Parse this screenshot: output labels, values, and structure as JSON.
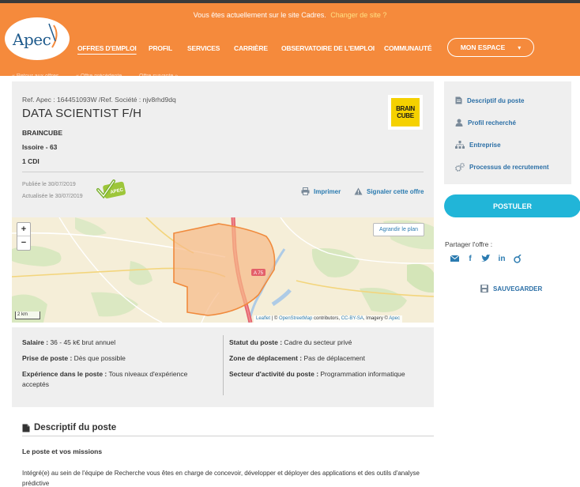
{
  "header": {
    "notice": "Vous êtes actuellement sur le site Cadres.",
    "notice_link": "Changer de site ?",
    "logo_text": "Apec",
    "nav": [
      "OFFRES D'EMPLOI",
      "PROFIL",
      "SERVICES",
      "CARRIÈRE",
      "OBSERVATOIRE DE L'EMPLOI",
      "COMMUNAUTÉ"
    ],
    "mon_espace": "MON ESPACE",
    "crumbs": [
      "« Retour aux offres",
      "« Offre précédente",
      "Offre suivante »"
    ]
  },
  "job": {
    "ref": "Ref. Apec : 164451093W /Ref. Société : njv8rhd9dq",
    "title": "DATA SCIENTIST F/H",
    "company": "BRAINCUBE",
    "location": "Issoire - 63",
    "contract": "1 CDI",
    "published": "Publiée le 30/07/2019",
    "updated": "Actualisée le 30/07/2019",
    "badge": "APEC",
    "logo_line1": "BRAIN",
    "logo_line2": "CUBE",
    "print": "Imprimer",
    "report": "Signaler cette offre"
  },
  "map": {
    "zoom_in": "+",
    "zoom_out": "−",
    "enlarge": "Agrandir le plan",
    "scale": "2 km",
    "road_label": "A 75",
    "attrib_leaflet": "Leaflet",
    "attrib_osm": "OpenStreetMap",
    "attrib_mid": "contributors,",
    "attrib_license": "CC-BY-SA",
    "attrib_imagery": ", Imagery ©",
    "attrib_apec": "Apec"
  },
  "details": {
    "salary_label": "Salaire :",
    "salary_value": " 36 - 45 k€ brut annuel",
    "start_label": "Prise de poste :",
    "start_value": " Dès que possible",
    "exp_label": "Expérience dans le poste :",
    "exp_value": " Tous niveaux d'expérience acceptés",
    "status_label": "Statut du poste :",
    "status_value": " Cadre du secteur privé",
    "travel_label": "Zone de déplacement :",
    "travel_value": " Pas de déplacement",
    "sector_label": "Secteur d'activité du poste :",
    "sector_value": " Programmation informatique"
  },
  "description": {
    "heading": "Descriptif du poste",
    "mission_title": "Le poste et vos missions",
    "mission_text": "Intégré(e) au sein de l'équipe de Recherche vous êtes en charge de concevoir, développer et déployer des applications et des outils d'analyse prédictive"
  },
  "sidebar": {
    "items": [
      "Descriptif du poste",
      "Profil recherché",
      "Entreprise",
      "Processus de recrutement"
    ],
    "apply": "POSTULER",
    "share_label": "Partager l'offre :",
    "save": "SAUVEGARDER"
  },
  "colors": {
    "header_orange": "#f58a3c",
    "link_blue": "#2b7bb0",
    "apply_cyan": "#21b5d8",
    "panel_grey": "#efefef"
  }
}
